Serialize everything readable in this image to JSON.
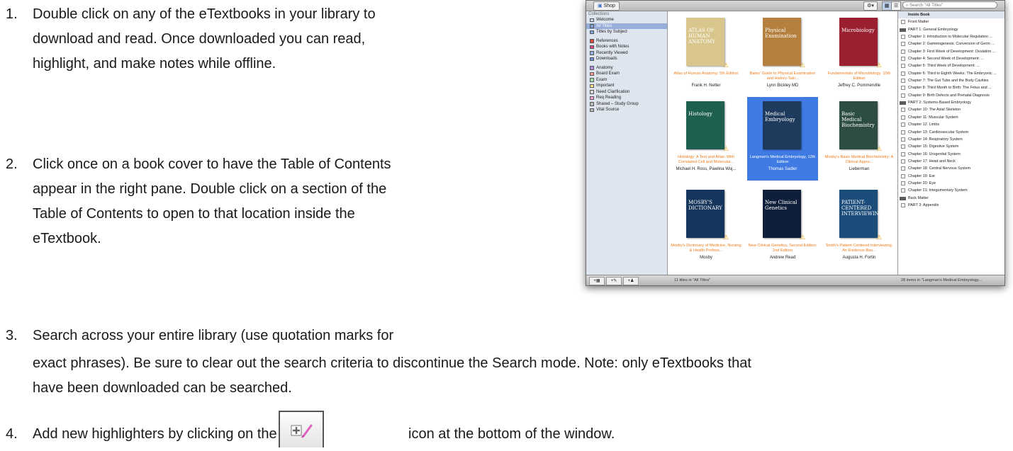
{
  "steps": [
    {
      "num": "1.",
      "lines": [
        "Double click on any of the eTextbooks in your library to",
        "download and read. Once downloaded you can read,",
        "highlight, and make notes while offline."
      ]
    },
    {
      "num": "2.",
      "lines": [
        "Click once on a book cover to have the Table of Contents",
        "appear in the right pane. Double click on a section of the",
        "Table of Contents to open to that location inside the",
        "eTextbook."
      ]
    },
    {
      "num": "3.",
      "lines": [
        "Search across your entire library (use quotation marks for",
        "exact phrases). Be sure to clear out the search criteria to discontinue the Search mode. Note: only eTextbooks that",
        "have been downloaded can be searched."
      ]
    },
    {
      "num": "4.",
      "text_before": "Add new highlighters by clicking on the",
      "text_after": "icon at the bottom of the window."
    }
  ],
  "toolbar": {
    "shop_label": "Shop",
    "search_placeholder": "Search \"All Titles\""
  },
  "sidebar": {
    "header": "Collections",
    "items": [
      {
        "label": "Welcome",
        "color": "#c8d4f0"
      },
      {
        "label": "All Titles",
        "selected": true,
        "color": "#7fa2dc"
      },
      {
        "label": "Titles by Subject",
        "color": "#7fa2dc"
      },
      {
        "label": "References",
        "color": "#d94a3a"
      },
      {
        "label": "Books with Notes",
        "color": "#d94a8a"
      },
      {
        "label": "Recently Viewed",
        "color": "#8fb0e0"
      },
      {
        "label": "Downloads",
        "color": "#6c8fd0"
      },
      {
        "label": "Anatomy",
        "color": "#b48ee0"
      },
      {
        "label": "Board Exam",
        "color": "#ff9d9d"
      },
      {
        "label": "Exam",
        "color": "#a8e0a8"
      },
      {
        "label": "Important",
        "color": "#ffe48a"
      },
      {
        "label": "Need Clarification",
        "color": "#d8d8d8"
      },
      {
        "label": "Req Reading",
        "color": "#ff9de0"
      },
      {
        "label": "Shared – Study Group",
        "color": "#bbbbbb"
      },
      {
        "label": "Vital Source",
        "color": "#bbbbbb"
      }
    ]
  },
  "books": [
    {
      "title": "Atlas of Human Anatomy: 5th Edition",
      "author": "Frank H. Netter",
      "cover_color": "#d8c68c",
      "cover_text": "ATLAS OF HUMAN ANATOMY",
      "warn": true
    },
    {
      "title": "Bates' Guide to Physical Examination and History-Taki...",
      "author": "Lynn Bickley MD",
      "cover_color": "#b57f3d",
      "cover_text": "Physical Examination",
      "warn": true
    },
    {
      "title": "Fundamentals of Microbiology: 10th Edition",
      "author": "Jeffrey C. Pommerville",
      "cover_color": "#9a1f30",
      "cover_text": "Microbiology",
      "warn": true
    },
    {
      "title": "Histology: A Text and Atlas: With Correlated Cell and Molecular...",
      "author": "Michael H. Ross, Pawlina Woj...",
      "cover_color": "#1f5f4f",
      "cover_text": "Histology",
      "warn": true
    },
    {
      "title": "Langman's Medical Embryology, 12th Edition",
      "author": "Thomas Sadler",
      "cover_color": "#1e3a5c",
      "cover_text": "Medical Embryology",
      "warn": false,
      "selected": true
    },
    {
      "title": "Mosby's Basic Medical Biochemistry: A Clinical Appro...",
      "author": "Lieberman",
      "cover_color": "#2e4d42",
      "cover_text": "Basic Medical Biochemistry",
      "warn": true
    },
    {
      "title": "Mosby's Dictionary of Medicine, Nursing & Health Profess...",
      "author": "Mosby",
      "cover_color": "#16355c",
      "cover_text": "MOSBY'S DICTIONARY",
      "warn": true
    },
    {
      "title": "New Clinical Genetics, Second Edition: 2nd Edition",
      "author": "Andrew Read",
      "cover_color": "#0f1e3a",
      "cover_text": "New Clinical Genetics",
      "warn": true
    },
    {
      "title": "Smith's Patient Centered Interviewing: An Evidence-Bas...",
      "author": "Augusta H. Fortin",
      "cover_color": "#1b4c7a",
      "cover_text": "PATIENT-CENTERED INTERVIEWING",
      "warn": true
    }
  ],
  "toc": [
    {
      "label": "Inside Book",
      "type": "header"
    },
    {
      "label": "Front Matter",
      "type": "page"
    },
    {
      "label": "PART 1: General Embryology",
      "type": "folder"
    },
    {
      "label": "Chapter 1: Introduction to Molecular Regulation ...",
      "type": "page"
    },
    {
      "label": "Chapter 2: Gametogenesis: Conversion of Germ ...",
      "type": "page"
    },
    {
      "label": "Chapter 3: First Week of Development: Ovulation ...",
      "type": "page"
    },
    {
      "label": "Chapter 4: Second Week of Development: ...",
      "type": "page"
    },
    {
      "label": "Chapter 5: Third Week of Development: ...",
      "type": "page"
    },
    {
      "label": "Chapter 6: Third to Eighth Weeks: The Embryonic ...",
      "type": "page"
    },
    {
      "label": "Chapter 7: The Gut Tube and the Body Cavities",
      "type": "page"
    },
    {
      "label": "Chapter 8: Third Month to Birth: The Fetus and ...",
      "type": "page"
    },
    {
      "label": "Chapter 9: Birth Defects and Prenatal Diagnosis",
      "type": "page"
    },
    {
      "label": "PART 2: Systems-Based Embryology",
      "type": "folder"
    },
    {
      "label": "Chapter 10: The Axial Skeleton",
      "type": "page"
    },
    {
      "label": "Chapter 11: Muscular System",
      "type": "page"
    },
    {
      "label": "Chapter 12: Limbs",
      "type": "page"
    },
    {
      "label": "Chapter 13: Cardiovascular System",
      "type": "page"
    },
    {
      "label": "Chapter 14: Respiratory System",
      "type": "page"
    },
    {
      "label": "Chapter 15: Digestive System",
      "type": "page"
    },
    {
      "label": "Chapter 16: Urogenital System",
      "type": "page"
    },
    {
      "label": "Chapter 17: Head and Neck",
      "type": "page"
    },
    {
      "label": "Chapter 18: Central Nervous System",
      "type": "page"
    },
    {
      "label": "Chapter 19: Ear",
      "type": "page"
    },
    {
      "label": "Chapter 20: Eye",
      "type": "page"
    },
    {
      "label": "Chapter 21: Integumentary System",
      "type": "page"
    },
    {
      "label": "Back Matter",
      "type": "folder"
    },
    {
      "label": "PART 3: Appendix",
      "type": "page"
    }
  ],
  "status": {
    "left": "11 titles in \"All Titles\"",
    "right": "28 items in \"Langman's Medical Embryology..."
  },
  "icons": {
    "shop": "shop-icon",
    "gear": "gear-icon",
    "search": "search-icon",
    "warning": "warning-icon",
    "highlighter": "add-highlighter-icon"
  }
}
